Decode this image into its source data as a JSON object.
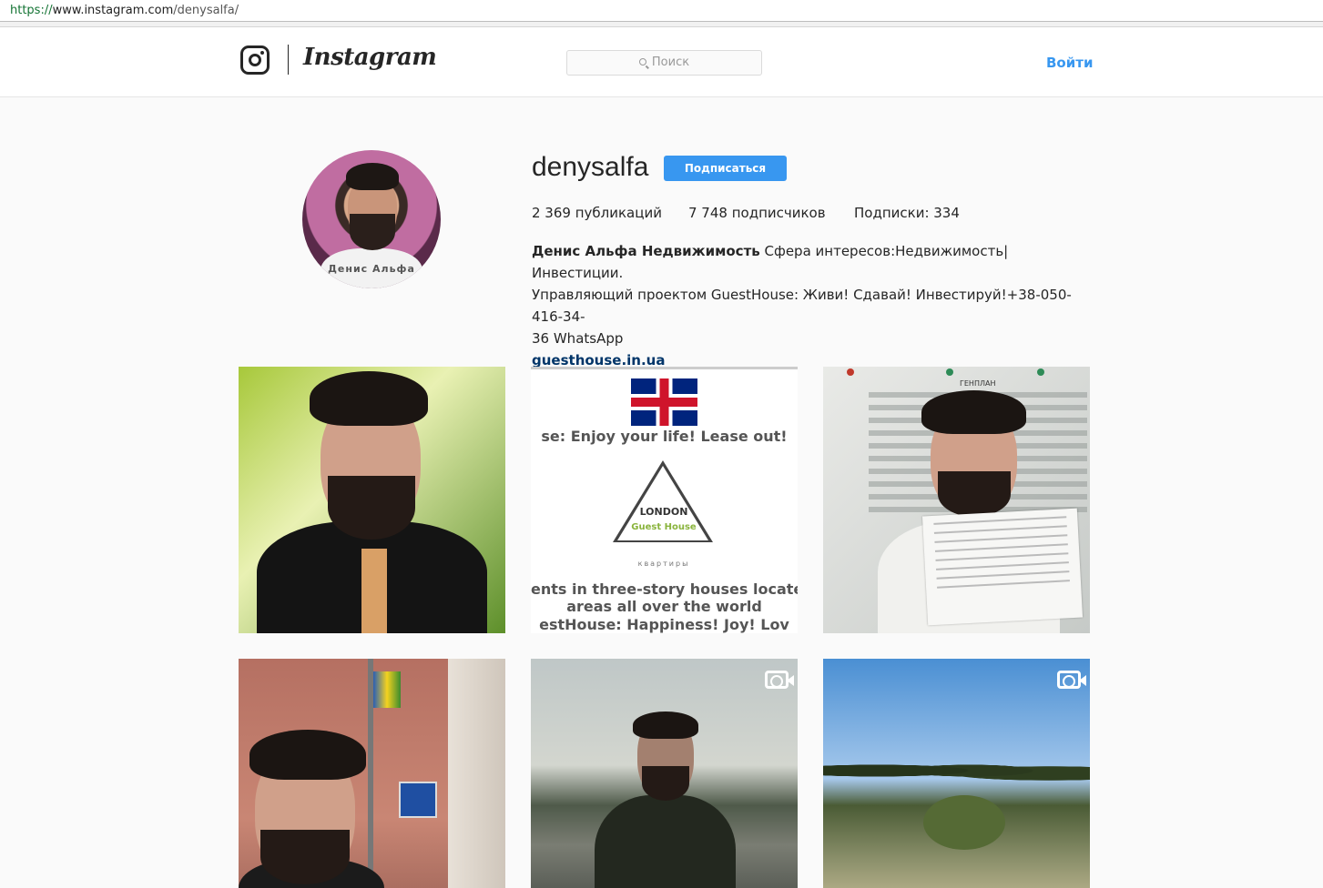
{
  "browser": {
    "url_scheme": "https://",
    "url_host": "www.instagram.com",
    "url_path": "/denysalfa/"
  },
  "header": {
    "wordmark": "Instagram",
    "search_placeholder": "Поиск",
    "login_label": "Войти"
  },
  "profile": {
    "avatar_caption": "Денис Альфа",
    "username": "denysalfa",
    "follow_label": "Подписаться",
    "stats": {
      "posts": "2 369 публикаций",
      "followers": "7 748 подписчиков",
      "following": "Подписки: 334"
    },
    "bio": {
      "name": "Денис Альфа Недвижимость",
      "line1": " Сфера интересов:Недвижимость|Инвестиции.",
      "line2": "Управляющий проектом GuestHouse: Живи! Сдавай! Инвестируй!+38-050-416-34-",
      "line3": "36 WhatsApp",
      "link": "guesthouse.in.ua"
    }
  },
  "posts": [
    {
      "kind": "photo"
    },
    {
      "kind": "photo",
      "text_top": "se: Enjoy your life! Lease out!",
      "logo_line1": "LONDON",
      "logo_line2": "Guest House",
      "logo_line3": "квартиры",
      "text_b1": "ents in three-story houses located",
      "text_b2": "areas all over the world",
      "text_b3": "estHouse: Happiness! Joy! Lov"
    },
    {
      "kind": "photo",
      "plan_label": "ГЕНПЛАН"
    },
    {
      "kind": "photo"
    },
    {
      "kind": "video",
      "icon": "video-camera-icon"
    },
    {
      "kind": "video",
      "icon": "video-camera-icon"
    }
  ],
  "colors": {
    "accent": "#3897f0",
    "link": "#003569",
    "background": "#fafafa"
  }
}
